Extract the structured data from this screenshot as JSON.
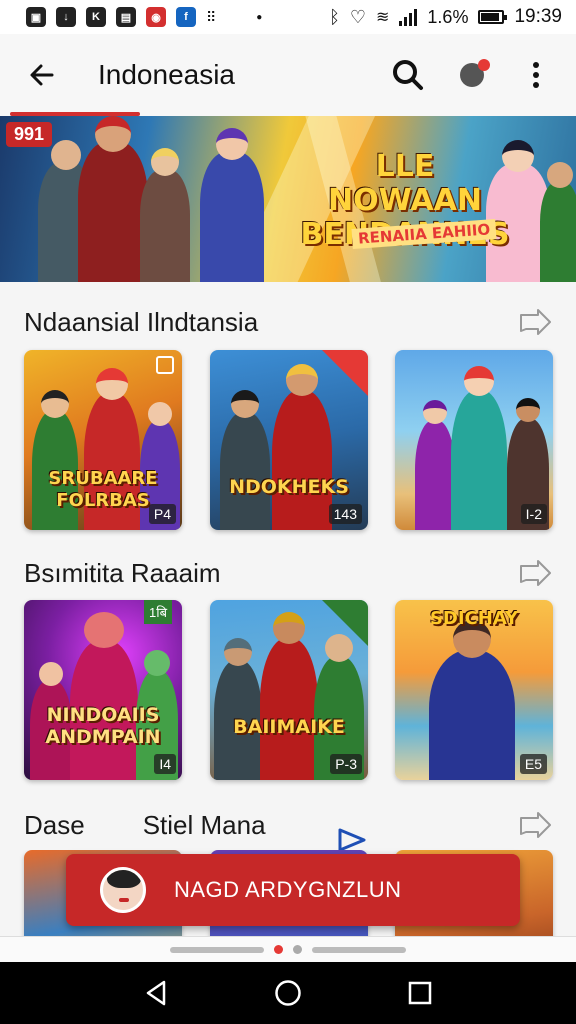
{
  "status_bar": {
    "left_icons": [
      "image-notification-icon",
      "download-icon",
      "app-notification-icon",
      "photo-notification-icon",
      "shield-notification-icon",
      "facebook-notification-icon",
      "dots-icon"
    ],
    "battery_level": "1.6%",
    "time": "19:39"
  },
  "app_bar": {
    "title": "Indoneasia"
  },
  "banner": {
    "badge": "991",
    "title": "LLE NOWAAN BENDANNES",
    "subtitle": "RENAIIA EAHIIO"
  },
  "sections": [
    {
      "title": "Ndaansial Ilndtansia",
      "cards": [
        {
          "logo": "SRUBAARE FOLRBAS",
          "count": "P4"
        },
        {
          "logo": "NDOKHEKS",
          "count": "143"
        },
        {
          "logo": "",
          "count": "I-2"
        }
      ]
    },
    {
      "title": "Bsımitita Raaaim",
      "cards": [
        {
          "logo": "NINDOAIIS ANDMPAIN",
          "count": "I4",
          "badge": "1बि"
        },
        {
          "logo": "BAIIMAIKE",
          "count": "P-3"
        },
        {
          "logo": "SDICHAY",
          "count": "E5"
        }
      ]
    },
    {
      "title_left": "Dase",
      "title_right": "Stiel Mana"
    }
  ],
  "toast": {
    "text": "NAGD ARDYGNZLUN"
  },
  "colors": {
    "accent": "#d32f2f",
    "toast_bg": "#c62828",
    "background": "#f5f5f5"
  }
}
